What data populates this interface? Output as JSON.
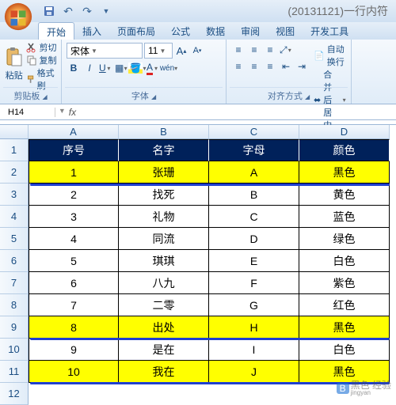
{
  "title": "(20131121)一行内符",
  "tabs": [
    "开始",
    "插入",
    "页面布局",
    "公式",
    "数据",
    "审阅",
    "视图",
    "开发工具"
  ],
  "clipboard": {
    "paste": "粘贴",
    "cut": "剪切",
    "copy": "复制",
    "format": "格式刷",
    "title": "剪贴板"
  },
  "font": {
    "name": "宋体",
    "size": "11",
    "title": "字体"
  },
  "align": {
    "wrap": "自动换行",
    "merge": "合并后居中",
    "title": "对齐方式"
  },
  "namebox": "H14",
  "columns": [
    "A",
    "B",
    "C",
    "D"
  ],
  "header": [
    "序号",
    "名字",
    "字母",
    "颜色"
  ],
  "rows": [
    {
      "n": 1,
      "c": [
        "1",
        "张珊",
        "A",
        "黑色"
      ],
      "y": true
    },
    {
      "n": 2,
      "c": [
        "2",
        "找死",
        "B",
        "黄色"
      ]
    },
    {
      "n": 3,
      "c": [
        "3",
        "礼物",
        "C",
        "蓝色"
      ]
    },
    {
      "n": 4,
      "c": [
        "4",
        "同流",
        "D",
        "绿色"
      ]
    },
    {
      "n": 5,
      "c": [
        "5",
        "琪琪",
        "E",
        "白色"
      ]
    },
    {
      "n": 6,
      "c": [
        "6",
        "八九",
        "F",
        "紫色"
      ]
    },
    {
      "n": 7,
      "c": [
        "7",
        "二零",
        "G",
        "红色"
      ]
    },
    {
      "n": 8,
      "c": [
        "8",
        "出处",
        "H",
        "黑色"
      ],
      "y": true
    },
    {
      "n": 9,
      "c": [
        "9",
        "是在",
        "I",
        "白色"
      ]
    },
    {
      "n": 10,
      "c": [
        "10",
        "我在",
        "J",
        "黑色"
      ],
      "y": true
    }
  ],
  "row_labels": [
    "1",
    "2",
    "3",
    "4",
    "5",
    "6",
    "7",
    "8",
    "9",
    "10",
    "11",
    "12"
  ],
  "watermark": {
    "brand": "B",
    "text": "黑色 经验",
    "sub": "jingyan"
  }
}
